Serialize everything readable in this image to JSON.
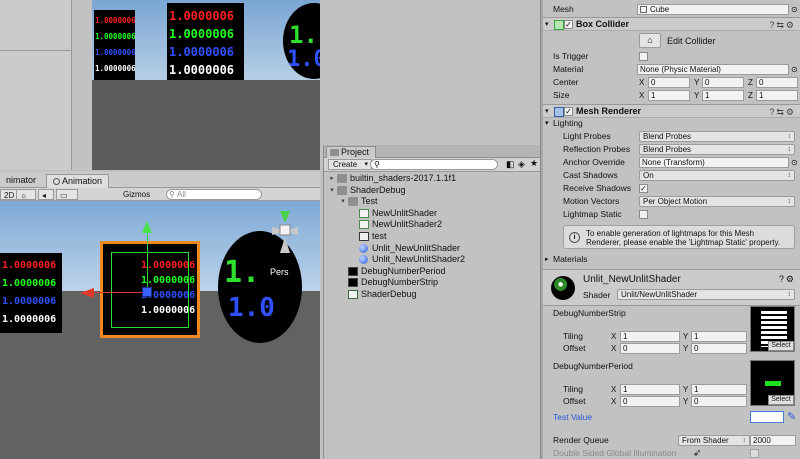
{
  "game_view": {
    "cube_a": [
      "1.0000006",
      "1.0000006",
      "1.0000006",
      "1.0000006"
    ],
    "cube_b": [
      "1.0000006",
      "1.0000006",
      "1.0000006",
      "1.0000006"
    ],
    "sphere_text": [
      "1.",
      "1.0"
    ]
  },
  "scene_tabs": {
    "animator": "nimator",
    "animation": "Animation"
  },
  "scene_toolbar": {
    "mode_2d": "2D",
    "gizmos": "Gizmos",
    "search_placeholder": "All"
  },
  "scene_view": {
    "cube_left": [
      "1.0000006",
      "1.0000006",
      "1.0000006",
      "1.0000006"
    ],
    "cube_sel": [
      "1.0000006",
      "1.0000006",
      "1.0000006",
      "1.0000006"
    ],
    "sphere_text": [
      "1.",
      "1.0"
    ],
    "persp_label": "Pers"
  },
  "project": {
    "tab_label": "Project",
    "create_label": "Create",
    "tree": [
      {
        "label": "builtin_shaders-2017.1.1f1",
        "depth": 0,
        "kind": "folder",
        "arrow": "▸"
      },
      {
        "label": "ShaderDebug",
        "depth": 0,
        "kind": "folder",
        "arrow": "▾"
      },
      {
        "label": "Test",
        "depth": 1,
        "kind": "folder",
        "arrow": "▾"
      },
      {
        "label": "NewUnlitShader",
        "depth": 2,
        "kind": "shader",
        "arrow": ""
      },
      {
        "label": "NewUnlitShader2",
        "depth": 2,
        "kind": "shader",
        "arrow": ""
      },
      {
        "label": "test",
        "depth": 2,
        "kind": "scene",
        "arrow": ""
      },
      {
        "label": "Unlit_NewUnlitShader",
        "depth": 2,
        "kind": "material",
        "arrow": ""
      },
      {
        "label": "Unlit_NewUnlitShader2",
        "depth": 2,
        "kind": "material",
        "arrow": ""
      },
      {
        "label": "DebugNumberPeriod",
        "depth": 1,
        "kind": "texture",
        "arrow": ""
      },
      {
        "label": "DebugNumberStrip",
        "depth": 1,
        "kind": "texture",
        "arrow": ""
      },
      {
        "label": "ShaderDebug",
        "depth": 1,
        "kind": "script",
        "arrow": ""
      }
    ]
  },
  "inspector": {
    "mesh_label": "Mesh",
    "mesh_value": "Cube",
    "box_collider": {
      "title": "Box Collider",
      "edit_label": "Edit Collider",
      "is_trigger": "Is Trigger",
      "material_label": "Material",
      "material_value": "None (Physic Material)",
      "center_label": "Center",
      "center": {
        "x": "0",
        "y": "0",
        "z": "0"
      },
      "size_label": "Size",
      "size": {
        "x": "1",
        "y": "1",
        "z": "1"
      }
    },
    "mesh_renderer": {
      "title": "Mesh Renderer",
      "lighting": "Lighting",
      "light_probes_label": "Light Probes",
      "light_probes_value": "Blend Probes",
      "reflection_probes_label": "Reflection Probes",
      "reflection_probes_value": "Blend Probes",
      "anchor_override_label": "Anchor Override",
      "anchor_override_value": "None (Transform)",
      "cast_shadows_label": "Cast Shadows",
      "cast_shadows_value": "On",
      "receive_shadows_label": "Receive Shadows",
      "motion_vectors_label": "Motion Vectors",
      "motion_vectors_value": "Per Object Motion",
      "lightmap_static_label": "Lightmap Static",
      "info_text": "To enable generation of lightmaps for this Mesh Renderer, please enable the 'Lightmap Static' property.",
      "materials_label": "Materials"
    },
    "material": {
      "title": "Unlit_NewUnlitShader",
      "shader_label": "Shader",
      "shader_value": "Unlit/NewUnlitShader",
      "strip_label": "DebugNumberStrip",
      "period_label": "DebugNumberPeriod",
      "tiling_label": "Tiling",
      "offset_label": "Offset",
      "strip_tiling": {
        "x": "1",
        "y": "1"
      },
      "strip_offset": {
        "x": "0",
        "y": "0"
      },
      "period_tiling": {
        "x": "1",
        "y": "1"
      },
      "period_offset": {
        "x": "0",
        "y": "0"
      },
      "select_label": "Select",
      "test_value_label": "Test Value",
      "render_queue_label": "Render Queue",
      "render_queue_mode": "From Shader",
      "render_queue_value": "2000",
      "double_sided_label": "Double Sided Global Illumination"
    }
  }
}
